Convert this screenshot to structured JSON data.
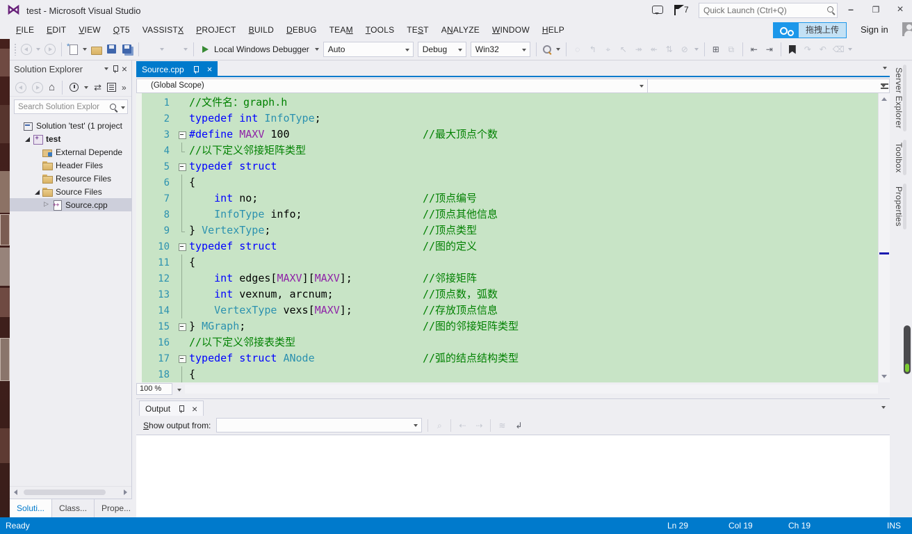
{
  "colors": {
    "accent": "#007ACC",
    "status": "#007ACC",
    "chrome": "#EEEEF2",
    "border": "#CCCEDB",
    "logo": "#68217A",
    "upload": "#1C97EA",
    "editor_bg": "#C8E4C6",
    "comment": "#008000",
    "keyword": "#0000FF",
    "type": "#2B91AF",
    "macro": "#8F23A7",
    "linenum": "#2B91AF"
  },
  "icons": {
    "vs-logo": "bowtie ⋈",
    "feedback": "speech-bubble",
    "notifications-flag": "flag",
    "search": "magnifier",
    "minimize": "–",
    "restore": "❐",
    "close": "×",
    "run": "green-triangle",
    "bookmark": "black-flag",
    "pin": "pushpin",
    "home": "⌂",
    "refresh": "⇄"
  },
  "titlebar": {
    "title": "test - Microsoft Visual Studio",
    "notification_count": "7",
    "quick_launch_placeholder": "Quick Launch (Ctrl+Q)"
  },
  "menubar": {
    "items": [
      {
        "label": "FILE",
        "u": 0
      },
      {
        "label": "EDIT",
        "u": 0
      },
      {
        "label": "VIEW",
        "u": 0
      },
      {
        "label": "QT5",
        "u": 0
      },
      {
        "label": "VASSISTX",
        "u": 7
      },
      {
        "label": "PROJECT",
        "u": 0
      },
      {
        "label": "BUILD",
        "u": 0
      },
      {
        "label": "DEBUG",
        "u": 0
      },
      {
        "label": "TEAM",
        "u": 3
      },
      {
        "label": "TOOLS",
        "u": 0
      },
      {
        "label": "TEST",
        "u": 2
      },
      {
        "label": "ANALYZE",
        "u": 1
      },
      {
        "label": "WINDOW",
        "u": 0
      },
      {
        "label": "HELP",
        "u": 0
      }
    ],
    "upload_label": "拖拽上传",
    "sign_in": "Sign in"
  },
  "toolbar": {
    "debugger_label": "Local Windows Debugger",
    "combo_auto": "Auto",
    "combo_debug": "Debug",
    "combo_platform": "Win32"
  },
  "solution_explorer": {
    "title": "Solution Explorer",
    "search_placeholder": "Search Solution Explor",
    "tree": [
      {
        "id": "solution",
        "label": "Solution 'test' (1 project",
        "indent": 0,
        "icon": "ti-solution",
        "arrow": "none"
      },
      {
        "id": "project-test",
        "label": "test",
        "indent": 1,
        "icon": "ti-project",
        "arrow": "expanded",
        "bold": true
      },
      {
        "id": "external-dependencies",
        "label": "External Depende",
        "indent": 2,
        "icon": "ti-extdep",
        "arrow": "none"
      },
      {
        "id": "header-files",
        "label": "Header Files",
        "indent": 2,
        "icon": "ti-folder",
        "arrow": "none"
      },
      {
        "id": "resource-files",
        "label": "Resource Files",
        "indent": 2,
        "icon": "ti-folder",
        "arrow": "none"
      },
      {
        "id": "source-files",
        "label": "Source Files",
        "indent": 2,
        "icon": "ti-folder",
        "arrow": "expanded"
      },
      {
        "id": "source-cpp",
        "label": "Source.cpp",
        "indent": 3,
        "icon": "ti-cpp",
        "arrow": "collapsed",
        "selected": true
      }
    ],
    "bottom_tabs": [
      {
        "label": "Soluti...",
        "active": true
      },
      {
        "label": "Class...",
        "active": false
      },
      {
        "label": "Prope...",
        "active": false
      }
    ]
  },
  "editor": {
    "tab_label": "Source.cpp",
    "scope_dropdown": "(Global Scope)",
    "zoom_level": "100 %",
    "lines": [
      {
        "num": "1",
        "fold": "none",
        "tokens": [
          {
            "c": "com",
            "s": "//文件名：graph.h"
          }
        ]
      },
      {
        "num": "2",
        "fold": "none",
        "tokens": [
          {
            "c": "kw",
            "s": "typedef"
          },
          {
            "c": "pl",
            "s": " "
          },
          {
            "c": "kw",
            "s": "int"
          },
          {
            "c": "pl",
            "s": " "
          },
          {
            "c": "type",
            "s": "InfoType"
          },
          {
            "c": "pl",
            "s": ";"
          }
        ]
      },
      {
        "num": "3",
        "fold": "box",
        "tokens": [
          {
            "c": "kw",
            "s": "#define"
          },
          {
            "c": "pl",
            "s": " "
          },
          {
            "c": "macro",
            "s": "MAXV"
          },
          {
            "c": "pl",
            "s": " 100"
          }
        ],
        "comment": "//最大顶点个数"
      },
      {
        "num": "4",
        "fold": "end",
        "tokens": [
          {
            "c": "com",
            "s": "//以下定义邻接矩阵类型"
          }
        ]
      },
      {
        "num": "5",
        "fold": "box",
        "tokens": [
          {
            "c": "kw",
            "s": "typedef"
          },
          {
            "c": "pl",
            "s": " "
          },
          {
            "c": "kw",
            "s": "struct"
          }
        ]
      },
      {
        "num": "6",
        "fold": "line",
        "tokens": [
          {
            "c": "pl",
            "s": "{"
          }
        ]
      },
      {
        "num": "7",
        "fold": "line",
        "tokens": [
          {
            "c": "pl",
            "s": "    "
          },
          {
            "c": "kw",
            "s": "int"
          },
          {
            "c": "pl",
            "s": " no;"
          }
        ],
        "comment": "//顶点编号"
      },
      {
        "num": "8",
        "fold": "line",
        "tokens": [
          {
            "c": "pl",
            "s": "    "
          },
          {
            "c": "type",
            "s": "InfoType"
          },
          {
            "c": "pl",
            "s": " info;"
          }
        ],
        "comment": "//顶点其他信息"
      },
      {
        "num": "9",
        "fold": "end",
        "tokens": [
          {
            "c": "pl",
            "s": "} "
          },
          {
            "c": "type",
            "s": "VertexType"
          },
          {
            "c": "pl",
            "s": ";"
          }
        ],
        "comment": "//顶点类型"
      },
      {
        "num": "10",
        "fold": "box",
        "tokens": [
          {
            "c": "kw",
            "s": "typedef"
          },
          {
            "c": "pl",
            "s": " "
          },
          {
            "c": "kw",
            "s": "struct"
          }
        ],
        "comment": "//图的定义"
      },
      {
        "num": "11",
        "fold": "line",
        "tokens": [
          {
            "c": "pl",
            "s": "{"
          }
        ]
      },
      {
        "num": "12",
        "fold": "line",
        "tokens": [
          {
            "c": "pl",
            "s": "    "
          },
          {
            "c": "kw",
            "s": "int"
          },
          {
            "c": "pl",
            "s": " edges["
          },
          {
            "c": "macro",
            "s": "MAXV"
          },
          {
            "c": "pl",
            "s": "]["
          },
          {
            "c": "macro",
            "s": "MAXV"
          },
          {
            "c": "pl",
            "s": "];"
          }
        ],
        "comment": "//邻接矩阵"
      },
      {
        "num": "13",
        "fold": "line",
        "tokens": [
          {
            "c": "pl",
            "s": "    "
          },
          {
            "c": "kw",
            "s": "int"
          },
          {
            "c": "pl",
            "s": " vexnum, arcnum;"
          }
        ],
        "comment": "//顶点数，弧数"
      },
      {
        "num": "14",
        "fold": "line",
        "tokens": [
          {
            "c": "pl",
            "s": "    "
          },
          {
            "c": "type",
            "s": "VertexType"
          },
          {
            "c": "pl",
            "s": " vexs["
          },
          {
            "c": "macro",
            "s": "MAXV"
          },
          {
            "c": "pl",
            "s": "];"
          }
        ],
        "comment": "//存放顶点信息"
      },
      {
        "num": "15",
        "fold": "box",
        "tokens": [
          {
            "c": "pl",
            "s": "} "
          },
          {
            "c": "type",
            "s": "MGraph"
          },
          {
            "c": "pl",
            "s": ";"
          }
        ],
        "comment": "//图的邻接矩阵类型"
      },
      {
        "num": "16",
        "fold": "none",
        "tokens": [
          {
            "c": "com",
            "s": "//以下定义邻接表类型"
          }
        ]
      },
      {
        "num": "17",
        "fold": "box",
        "tokens": [
          {
            "c": "kw",
            "s": "typedef"
          },
          {
            "c": "pl",
            "s": " "
          },
          {
            "c": "kw",
            "s": "struct"
          },
          {
            "c": "pl",
            "s": " "
          },
          {
            "c": "type",
            "s": "ANode"
          }
        ],
        "comment": "//弧的结点结构类型"
      },
      {
        "num": "18",
        "fold": "line",
        "tokens": [
          {
            "c": "pl",
            "s": "{"
          }
        ]
      }
    ]
  },
  "output_panel": {
    "tab_label": "Output",
    "show_output_from": "Show output from:"
  },
  "side_tabs": [
    "Server Explorer",
    "Toolbox",
    "Properties"
  ],
  "statusbar": {
    "state": "Ready",
    "line": "Ln 29",
    "column": "Col 19",
    "character": "Ch 19",
    "mode": "INS"
  }
}
